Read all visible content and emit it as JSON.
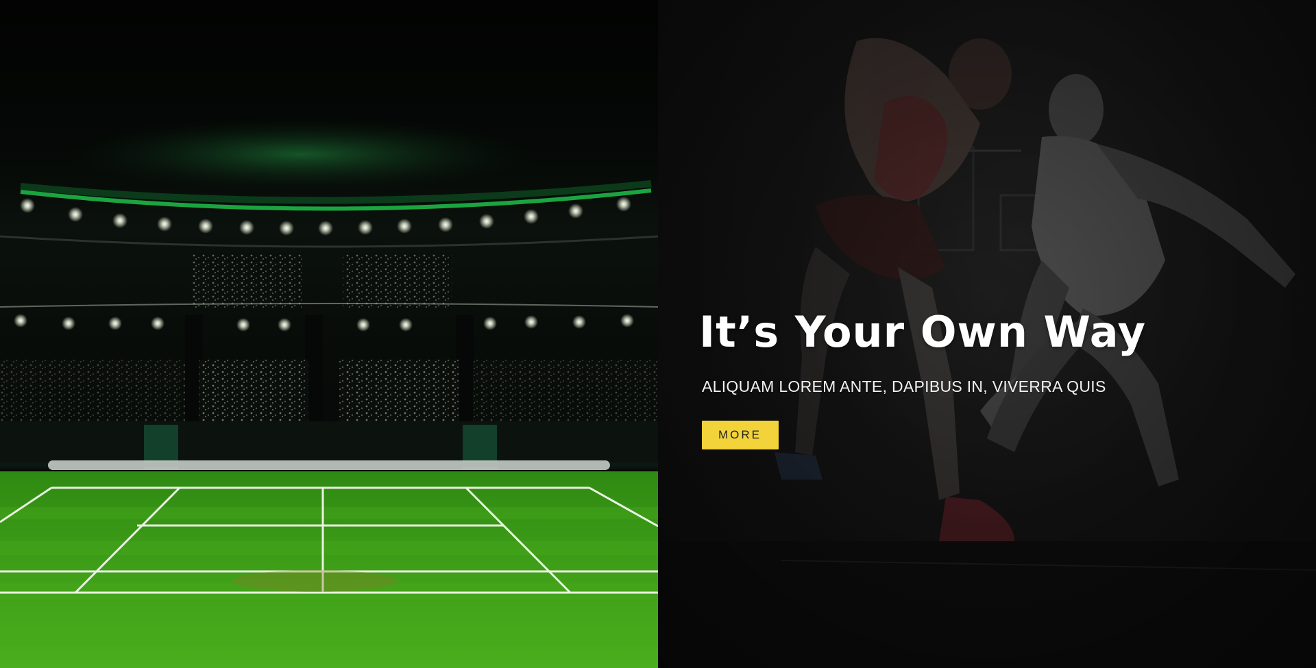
{
  "hero": {
    "title": "It’s Your Own Way",
    "subtitle": "ALIQUAM LOREM ANTE, DAPIBUS IN, VIVERRA QUIS",
    "cta_label": "MORE"
  },
  "colors": {
    "accent": "#f2d33a",
    "court_grass": "#3a9a16",
    "stadium_glow": "#1fbf4a",
    "right_panel_bg": "#1d1d1d"
  },
  "images": {
    "left": "tennis-stadium-photo",
    "right": "basketball-players-photo"
  }
}
